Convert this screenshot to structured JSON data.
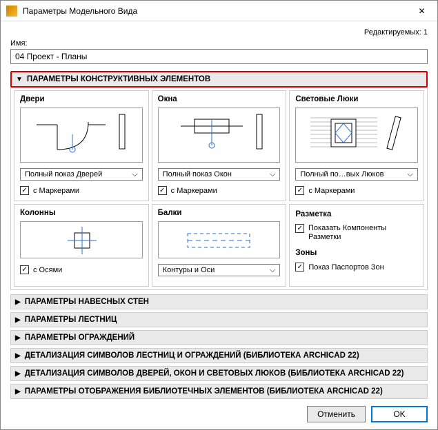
{
  "window": {
    "title": "Параметры Модельного Вида",
    "close_glyph": "✕"
  },
  "editable_count": "Редактируемых: 1",
  "name_label": "Имя:",
  "name_value": "04 Проект - Планы",
  "section_construct": {
    "title": "ПАРАМЕТРЫ КОНСТРУКТИВНЫХ ЭЛЕМЕНТОВ",
    "doors": {
      "title": "Двери",
      "select": "Полный показ Дверей",
      "chk": "с Маркерами"
    },
    "windows": {
      "title": "Окна",
      "select": "Полный показ Окон",
      "chk": "с Маркерами"
    },
    "skylights": {
      "title": "Световые Люки",
      "select": "Полный по…вых Люков",
      "chk": "с Маркерами"
    },
    "columns": {
      "title": "Колонны",
      "chk": "с Осями"
    },
    "beams": {
      "title": "Балки",
      "select": "Контуры и Оси"
    },
    "markup": {
      "title": "Разметка",
      "chk": "Показать Компоненты Разметки"
    },
    "zones": {
      "title": "Зоны",
      "chk": "Показ Паспортов Зон"
    }
  },
  "collapsed_sections": [
    "ПАРАМЕТРЫ НАВЕСНЫХ СТЕН",
    "ПАРАМЕТРЫ ЛЕСТНИЦ",
    "ПАРАМЕТРЫ ОГРАЖДЕНИЙ",
    "ДЕТАЛИЗАЦИЯ СИМВОЛОВ ЛЕСТНИЦ И ОГРАЖДЕНИЙ (БИБЛИОТЕКА ARCHICAD 22)",
    "ДЕТАЛИЗАЦИЯ СИМВОЛОВ ДВЕРЕЙ, ОКОН И СВЕТОВЫХ ЛЮКОВ (БИБЛИОТЕКА ARCHICAD 22)",
    "ПАРАМЕТРЫ ОТОБРАЖЕНИЯ БИБЛИОТЕЧНЫХ ЭЛЕМЕНТОВ (БИБЛИОТЕКА ARCHICAD 22)"
  ],
  "buttons": {
    "cancel": "Отменить",
    "ok": "OK"
  }
}
